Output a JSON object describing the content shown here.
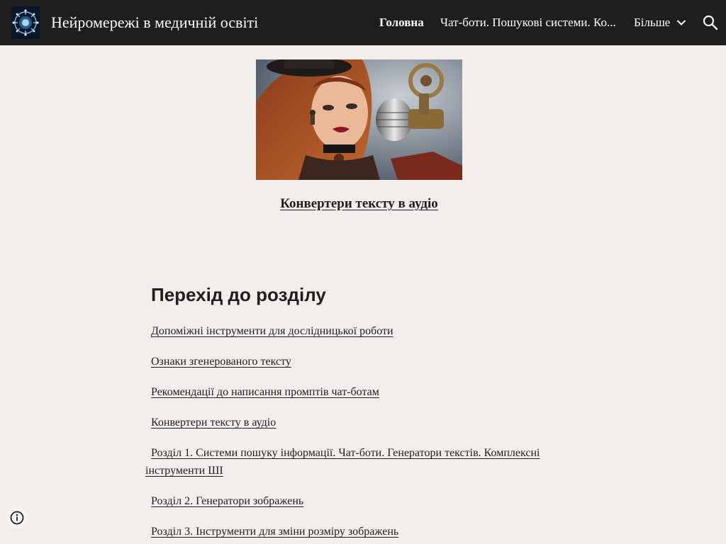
{
  "header": {
    "site_title": "Нейромережі в медичній освіті",
    "nav": {
      "home": "Головна",
      "chatbots": "Чат-боти. Пошукові системи. Ко...",
      "more": "Більше"
    },
    "search_icon": "search-icon",
    "more_icon": "chevron-down-icon",
    "background_color": "#1e1e1e"
  },
  "hero": {
    "image": "woman-with-vintage-microphone",
    "caption": "Конвертери тексту в аудіо"
  },
  "section": {
    "heading": "Перехід до розділу",
    "links": [
      "Допоміжні інструменти для дослідницької роботи",
      "Ознаки згенерованого тексту",
      "Рекомендації до написання промптів чат-ботам",
      "Конвертери тексту в аудіо",
      "Розділ 1. Системи пошуку інформації. Чат-боти. Генератори текстів. Комплексні інструменти ШІ",
      "Розділ 2. Генератори зображень",
      "Розділ 3. Інструменти для зміни розміру зображень"
    ]
  },
  "footer": {
    "info_icon": "info-icon"
  },
  "colors": {
    "page_background": "#f1eeeb",
    "text": "#1f1f1f"
  }
}
